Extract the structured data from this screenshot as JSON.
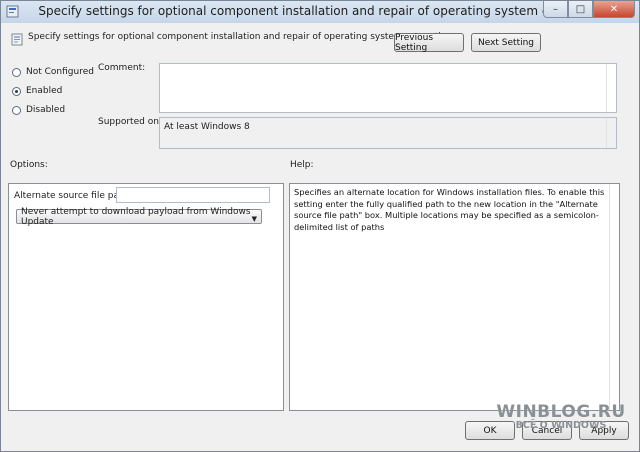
{
  "window": {
    "title": "Specify settings for optional component installation and repair of operating system corruption",
    "controls": {
      "minimize": "–",
      "maximize": "□",
      "close": "✕"
    }
  },
  "header": {
    "policy_name": "Specify settings for optional component installation and repair of operating system corruption",
    "prev_button": "Previous Setting",
    "next_button": "Next Setting"
  },
  "state": {
    "options": [
      {
        "label": "Not Configured",
        "selected": false
      },
      {
        "label": "Enabled",
        "selected": true
      },
      {
        "label": "Disabled",
        "selected": false
      }
    ]
  },
  "comment": {
    "label": "Comment:",
    "value": ""
  },
  "supported": {
    "label": "Supported on:",
    "value": "At least Windows 8"
  },
  "options_panel": {
    "heading": "Options:",
    "alt_source_label": "Alternate source file path",
    "alt_source_value": "",
    "dropdown_selected": "Never attempt to download payload from Windows Update"
  },
  "help_panel": {
    "heading": "Help:",
    "text": "Specifies an alternate location for Windows installation files. To enable this setting enter the fully qualified path to the new location in the \"Alternate source file path\" box. Multiple locations may be specified as a semicolon-delimited list of paths"
  },
  "footer": {
    "ok": "OK",
    "cancel": "Cancel",
    "apply": "Apply"
  },
  "watermark": {
    "main": "WINBLOG.RU",
    "sub": "ВСЁ О WINDOWS"
  },
  "icons": {
    "title": "policy-icon",
    "header": "policy-setting-icon",
    "dropdown": "chevron-down-icon"
  }
}
